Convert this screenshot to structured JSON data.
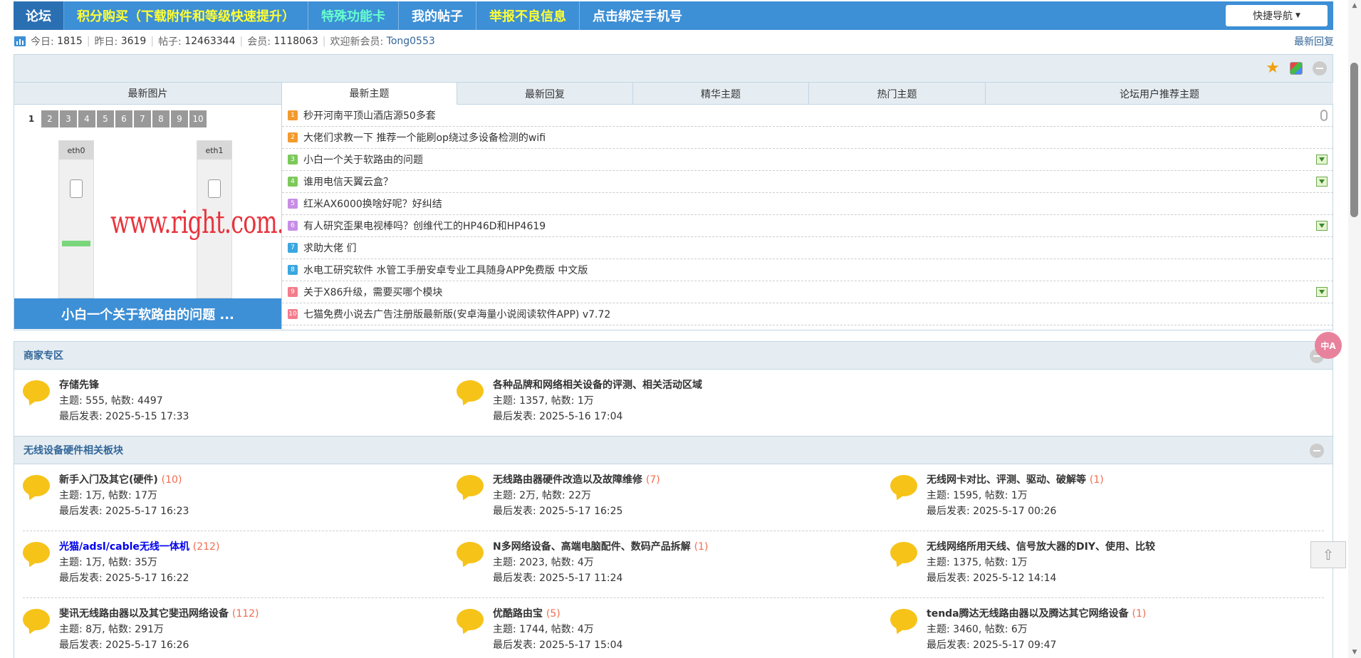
{
  "topnav": {
    "home": "论坛",
    "items": [
      {
        "label": "积分购买（下载附件和等级快速提升）",
        "color": "yellow"
      },
      {
        "label": "特殊功能卡",
        "color": "green"
      },
      {
        "label": "我的帖子",
        "color": "white"
      },
      {
        "label": "举报不良信息",
        "color": "yellow"
      },
      {
        "label": "点击绑定手机号",
        "color": "white"
      }
    ],
    "quick_nav": "快捷导航"
  },
  "stats": {
    "today_label": "今日:",
    "today": "1815",
    "yesterday_label": "昨日:",
    "yesterday": "3619",
    "posts_label": "帖子:",
    "posts": "12463344",
    "members_label": "会员:",
    "members": "1118063",
    "newest_label": "欢迎新会员:",
    "newest": "Tong0553",
    "latest_replies": "最新回复"
  },
  "showcase": {
    "left_title": "最新图片",
    "pages": [
      "1",
      "2",
      "3",
      "4",
      "5",
      "6",
      "7",
      "8",
      "9",
      "10"
    ],
    "current_page": "1",
    "slide": {
      "port_left": "eth0",
      "port_right": "eth1",
      "watermark": "www.right.com.cn",
      "caption": "小白一个关于软路由的问题 ..."
    },
    "tabs": [
      "最新主题",
      "最新回复",
      "精华主题",
      "热门主题",
      "论坛用户推荐主题"
    ],
    "active_tab": "最新主题",
    "threads": [
      {
        "n": "1",
        "title": "秒开河南平顶山酒店源50多套",
        "badge_color": "#f39a2c",
        "icon": "clip"
      },
      {
        "n": "2",
        "title": "大佬们求教一下 推荐一个能刷op绕过多设备检测的wifi",
        "badge_color": "#f39a2c",
        "icon": ""
      },
      {
        "n": "3",
        "title": "小白一个关于软路由的问题",
        "badge_color": "#7cc95a",
        "icon": "download"
      },
      {
        "n": "4",
        "title": "谁用电信天翼云盒？",
        "badge_color": "#7cc95a",
        "icon": "download"
      },
      {
        "n": "5",
        "title": "红米AX6000换啥好呢？好纠结",
        "badge_color": "#c78ee6",
        "icon": ""
      },
      {
        "n": "6",
        "title": "有人研究歪果电视棒吗？创维代工的HP46D和HP4619",
        "badge_color": "#c78ee6",
        "icon": "download"
      },
      {
        "n": "7",
        "title": "求助大佬 们",
        "badge_color": "#3aa7e0",
        "icon": ""
      },
      {
        "n": "8",
        "title": "水电工研究软件 水管工手册安卓专业工具随身APP免费版 中文版",
        "badge_color": "#3aa7e0",
        "icon": ""
      },
      {
        "n": "9",
        "title": "关于X86升级，需要买哪个模块",
        "badge_color": "#f47c8c",
        "icon": "download"
      },
      {
        "n": "10",
        "title": "七猫免费小说去广告注册版最新版(安卓海量小说阅读软件APP) v7.72",
        "badge_color": "#f47c8c",
        "icon": ""
      }
    ]
  },
  "sections": [
    {
      "title": "商家专区",
      "rows": [
        [
          {
            "name": "存储先锋",
            "count": "",
            "topics_label": "主题:",
            "topics": "555",
            "posts_label": "帖数:",
            "posts": "4497",
            "last_label": "最后发表:",
            "last": "2025-5-15 17:33",
            "blue": false
          },
          {
            "name": "各种品牌和网络相关设备的评测、相关活动区域",
            "count": "",
            "topics_label": "主题:",
            "topics": "1357",
            "posts_label": "帖数:",
            "posts": "1万",
            "last_label": "最后发表:",
            "last": "2025-5-16 17:04",
            "blue": false
          }
        ]
      ]
    },
    {
      "title": "无线设备硬件相关板块",
      "rows": [
        [
          {
            "name": "新手入门及其它(硬件)",
            "count": "(10)",
            "topics_label": "主题:",
            "topics": "1万",
            "posts_label": "帖数:",
            "posts": "17万",
            "last_label": "最后发表:",
            "last": "2025-5-17 16:23",
            "blue": false
          },
          {
            "name": "无线路由器硬件改造以及故障维修",
            "count": "(7)",
            "topics_label": "主题:",
            "topics": "2万",
            "posts_label": "帖数:",
            "posts": "22万",
            "last_label": "最后发表:",
            "last": "2025-5-17 16:25",
            "blue": false
          },
          {
            "name": "无线网卡对比、评测、驱动、破解等",
            "count": "(1)",
            "topics_label": "主题:",
            "topics": "1595",
            "posts_label": "帖数:",
            "posts": "1万",
            "last_label": "最后发表:",
            "last": "2025-5-17 00:26",
            "blue": false
          }
        ],
        [
          {
            "name": "光猫/adsl/cable无线一体机",
            "count": "(212)",
            "topics_label": "主题:",
            "topics": "1万",
            "posts_label": "帖数:",
            "posts": "35万",
            "last_label": "最后发表:",
            "last": "2025-5-17 16:22",
            "blue": true
          },
          {
            "name": "N多网络设备、高端电脑配件、数码产品拆解",
            "count": "(1)",
            "topics_label": "主题:",
            "topics": "2023",
            "posts_label": "帖数:",
            "posts": "4万",
            "last_label": "最后发表:",
            "last": "2025-5-17 11:24",
            "blue": false
          },
          {
            "name": "无线网络所用天线、信号放大器的DIY、使用、比较",
            "count": "",
            "topics_label": "主题:",
            "topics": "1375",
            "posts_label": "帖数:",
            "posts": "1万",
            "last_label": "最后发表:",
            "last": "2025-5-12 14:14",
            "blue": false
          }
        ],
        [
          {
            "name": "斐讯无线路由器以及其它斐迅网络设备",
            "count": "(112)",
            "topics_label": "主题:",
            "topics": "8万",
            "posts_label": "帖数:",
            "posts": "291万",
            "last_label": "最后发表:",
            "last": "2025-5-17 16:26",
            "blue": false
          },
          {
            "name": "优酷路由宝",
            "count": "(5)",
            "topics_label": "主题:",
            "topics": "1744",
            "posts_label": "帖数:",
            "posts": "4万",
            "last_label": "最后发表:",
            "last": "2025-5-17 15:04",
            "blue": false
          },
          {
            "name": "tenda腾达无线路由器以及腾达其它网络设备",
            "count": "(1)",
            "topics_label": "主题:",
            "topics": "3460",
            "posts_label": "帖数:",
            "posts": "6万",
            "last_label": "最后发表:",
            "last": "2025-5-17 09:47",
            "blue": false
          }
        ]
      ]
    }
  ],
  "widgets": {
    "translate_label": "中A"
  }
}
